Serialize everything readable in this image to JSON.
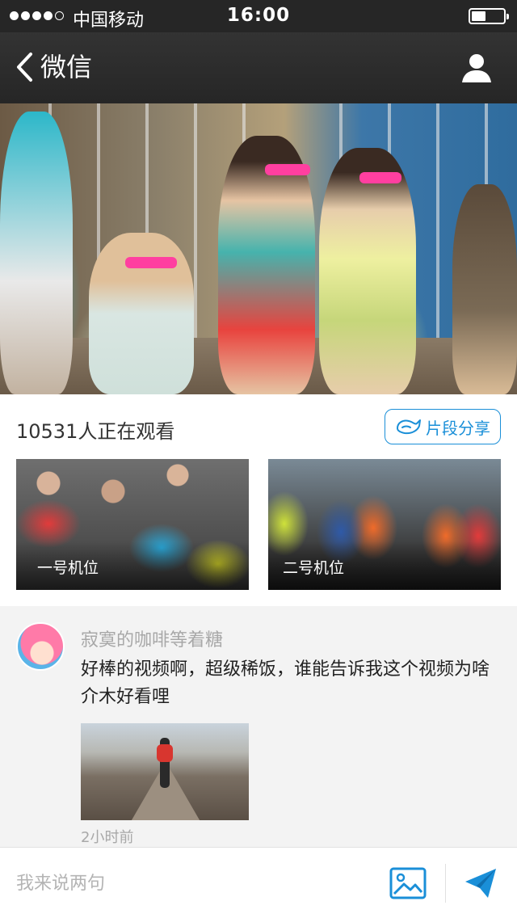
{
  "status_bar": {
    "carrier": "中国移动",
    "time": "16:00",
    "signal_bars": 4,
    "signal_total": 5,
    "battery_level": 0.45
  },
  "nav": {
    "back_label": "微信",
    "back_icon": "chevron-left-icon",
    "profile_icon": "user-icon"
  },
  "hero": {
    "description_icon": "hero-image"
  },
  "live": {
    "viewers_text": "10531人正在观看",
    "share_label": "片段分享",
    "share_icon": "share-icon",
    "cameras": [
      {
        "label": "一号机位"
      },
      {
        "label": "二号机位"
      }
    ]
  },
  "comment": {
    "username": "寂寞的咖啡等着糖",
    "text": "好棒的视频啊，超级稀饭，谁能告诉我这个视频为啥介木好看哩",
    "time": "2小时前"
  },
  "input_bar": {
    "placeholder": "我来说两句",
    "image_icon": "image-icon",
    "send_icon": "send-icon"
  },
  "colors": {
    "accent": "#1a8fd8",
    "navbar": "#2b2b2b",
    "muted_text": "#a8a8a8"
  }
}
